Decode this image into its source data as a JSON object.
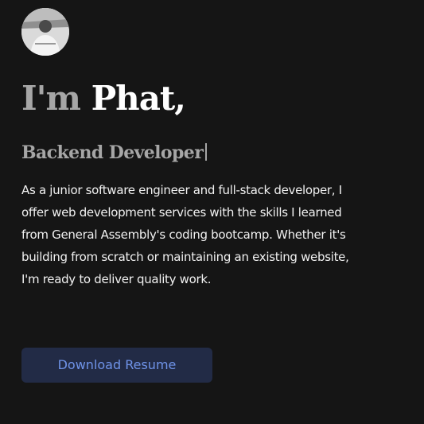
{
  "hero": {
    "avatar_icon": "profile-photo",
    "greeting": "I'm",
    "name": "Phat,",
    "role": "Backend Developer",
    "bio": "As a junior software engineer and full-stack developer, I offer web development services with the skills I learned from General Assembly's coding bootcamp. Whether it's building from scratch or maintaining an existing website, I'm ready to deliver quality work.",
    "download_label": "Download Resume"
  },
  "colors": {
    "background": "#151515",
    "muted_heading": "#a6a6a6",
    "name": "#ffffff",
    "button_bg": "#222b46",
    "button_text": "#6f93e8"
  }
}
